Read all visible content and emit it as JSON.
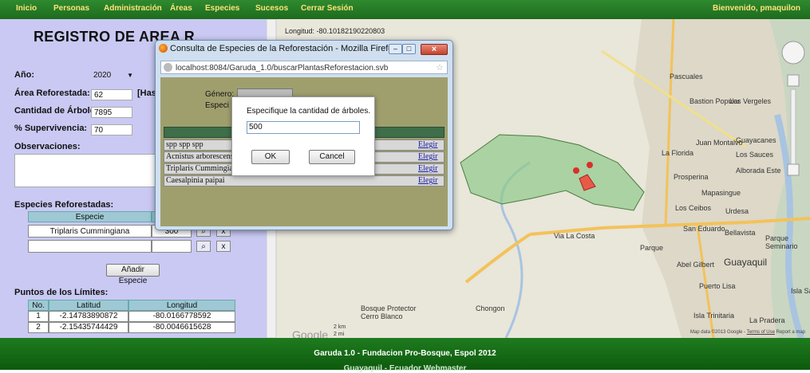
{
  "nav": {
    "items": [
      "Inicio",
      "Personas",
      "Administración",
      "Áreas",
      "Especies",
      "Sucesos",
      "Cerrar Sesión"
    ],
    "welcome": "Bienvenido, pmaquilon"
  },
  "form": {
    "title": "REGISTRO DE AREA R",
    "anio_label": "Año:",
    "anio_value": "2020",
    "area_label": "Área Reforestada:",
    "area_value": "62",
    "area_unit": "[Has",
    "cantidad_label": "Cantidad de Árboles:",
    "cantidad_value": "7895",
    "supervivencia_label": "% Supervivencia:",
    "supervivencia_value": "70",
    "observaciones_label": "Observaciones:",
    "especies_label": "Especies Reforestadas:",
    "especies_header": "Especie",
    "especie_row1_name": "Triplaris Cummingiana",
    "especie_row1_qty": "300",
    "remove_label": "x",
    "add_especie": "Añadir Especie",
    "puntos_label": "Puntos de los Límites:",
    "puntos_headers": [
      "No.",
      "Latitud",
      "Longitud"
    ],
    "puntos": [
      {
        "no": "1",
        "lat": "-2.14783890872",
        "lon": "-80.0166778592"
      },
      {
        "no": "2",
        "lat": "-2.15435744429",
        "lon": "-80.0046615628"
      }
    ]
  },
  "map": {
    "coords_label": "Longitud: -80.10182190220803",
    "labels": [
      "Pascuales",
      "Bastion Popular",
      "Los Vergeles",
      "La Florida",
      "Juan Montalvo",
      "Los Sauces",
      "Guayacanes",
      "Alborada Este",
      "Prosperina",
      "Mapasingue",
      "Los Ceibos",
      "Urdesa",
      "San Eduardo",
      "Bellavista",
      "Parque Seminario",
      "Guayaquil",
      "Abel Gilbert",
      "Puerto Lisa",
      "Isla Trinitaria",
      "La Pradera",
      "Isla Santay",
      "Chongon",
      "Bosque Protector Cerro Blanco",
      "Via La Costa",
      "Parque"
    ],
    "google_logo": "Google",
    "scale_km": "2 km",
    "scale_mi": "2 mi",
    "attribution": "Map data ©2013 Google",
    "terms": "Terms of Use",
    "report": "Report a map"
  },
  "popup": {
    "title": "Consulta de Especies de la Reforestación - Mozilla Firefox",
    "url": "localhost:8084/Garuda_1.0/buscarPlantasReforestacion.svb",
    "genero_label": "Género:",
    "especie_label": "Especi",
    "rows": [
      {
        "name": "spp spp spp",
        "link": "Elegir"
      },
      {
        "name": "Acnistus arborescens",
        "link": "Elegir"
      },
      {
        "name": "Triplaris Cummingia",
        "link": "Elegir"
      },
      {
        "name": "Caesalpinia paipai",
        "link": "Elegir"
      }
    ]
  },
  "dialog": {
    "prompt": "Especifique la cantidad de árboles.",
    "value": "500",
    "ok": "OK",
    "cancel": "Cancel"
  },
  "footer": {
    "line1": "Garuda 1.0 - Fundacion Pro-Bosque, Espol 2012",
    "line2": "Guayaquil - Ecuador Webmaster"
  },
  "colors": {
    "nav_bg": "#1d6b1d",
    "left_panel_bg": "#c9c9f3",
    "polygon_fill": "#8fc98a",
    "footer_bg": "#0d5a0d"
  }
}
